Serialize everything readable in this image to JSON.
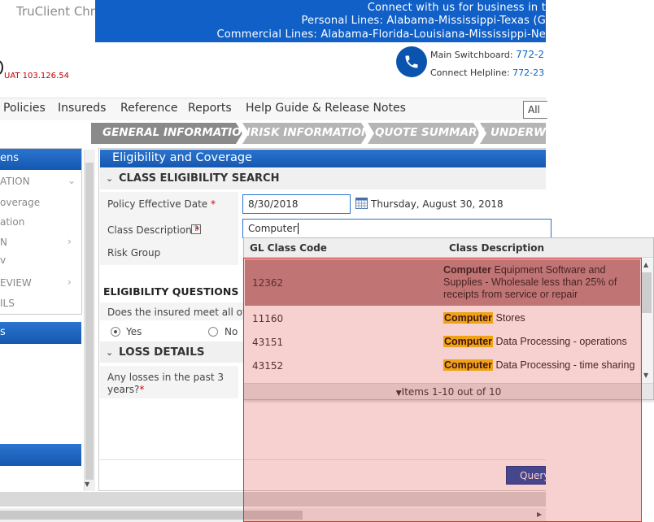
{
  "app_title": "TruClient Chromium",
  "banner": {
    "line1": "Connect with us for business in t",
    "line2": "Personal Lines: Alabama-Mississippi-Texas (G",
    "line3": "Commercial Lines: Alabama-Florida-Louisiana-Mississippi-Ne"
  },
  "environment_label": "UAT 103.126.54",
  "contacts": {
    "switchboard_label": "Main Switchboard:",
    "switchboard_number": "772-2",
    "helpline_label": "Connect Helpline:",
    "helpline_number": "772-23"
  },
  "nav": {
    "items": [
      "Policies",
      "Insureds",
      "Reference",
      "Reports",
      "Help Guide & Release Notes"
    ],
    "scope_select": "All"
  },
  "steps": [
    "GENERAL INFORMATION",
    "RISK INFORMATION",
    "QUOTE SUMMARY",
    "UNDERWRI"
  ],
  "left_panel": {
    "header": "ens",
    "items": [
      "ATION",
      "overage",
      "ation",
      "N",
      "v",
      "EVIEW",
      "ILS"
    ],
    "header2": "s"
  },
  "main": {
    "panel_title": "Eligibility and Coverage",
    "class_search_title": "CLASS ELIGIBILITY SEARCH",
    "policy_date_label": "Policy Effective Date",
    "policy_date_value": "8/30/2018",
    "policy_date_long": "Thursday, August 30, 2018",
    "class_desc_label": "Class Description",
    "class_desc_value": "Computer",
    "help_glyph": "?",
    "risk_group_label": "Risk Group",
    "elig_questions_title": "ELIGIBILITY QUESTIONS",
    "elig_question_text": "Does the insured meet all of the",
    "yes_label": "Yes",
    "no_label": "No",
    "loss_details_title": "LOSS DETAILS",
    "losses_question_line1": "Any losses in the past 3",
    "losses_question_line2": "years?",
    "required_mark": "*",
    "query_button": "Query"
  },
  "dropdown": {
    "col_code": "GL Class Code",
    "col_desc": "Class Description",
    "highlight_term": "Computer",
    "rows": [
      {
        "code": "12362",
        "desc_rest": "Equipment Software and Supplies - Wholesale less than 25% of receipts from service or repair"
      },
      {
        "code": "11160",
        "desc_rest": "Stores"
      },
      {
        "code": "43151",
        "desc_rest": "Data Processing - operations"
      },
      {
        "code": "43152",
        "desc_rest": "Data Processing - time sharing"
      }
    ],
    "footer": "Items 1-10 out of 10"
  },
  "colors": {
    "brand_blue": "#1060c8",
    "highlight_yellow": "#f7c411",
    "selection_overlay": "#d93030"
  }
}
